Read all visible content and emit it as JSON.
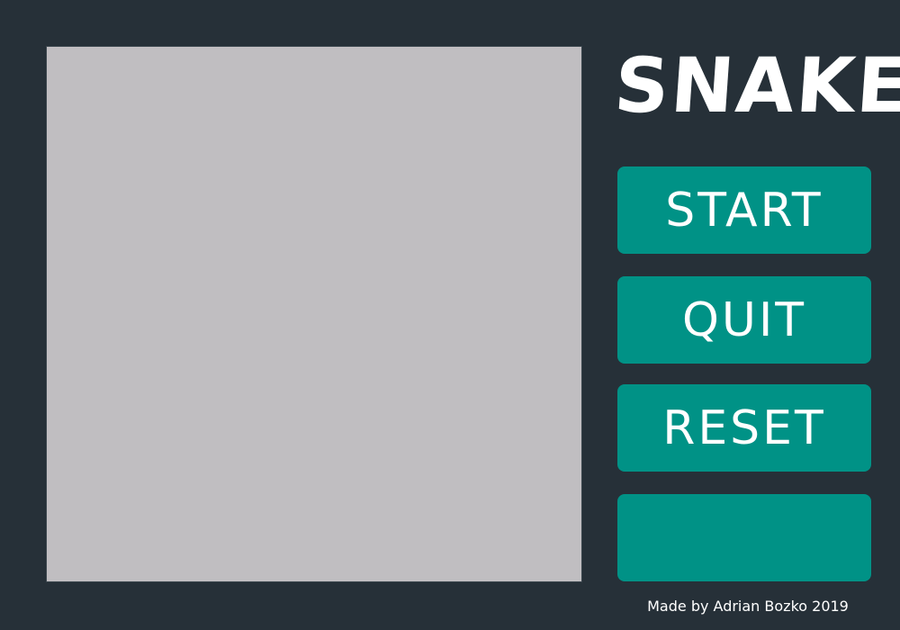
{
  "game": {
    "title": "SNAKE",
    "board_color": "#c0bec1",
    "background_color": "#263038",
    "accent_color": "#009286"
  },
  "buttons": {
    "start_label": "START",
    "quit_label": "QUIT",
    "reset_label": "RESET",
    "fourth_label": ""
  },
  "footer": {
    "credit": "Made by Adrian Bozko 2019"
  }
}
